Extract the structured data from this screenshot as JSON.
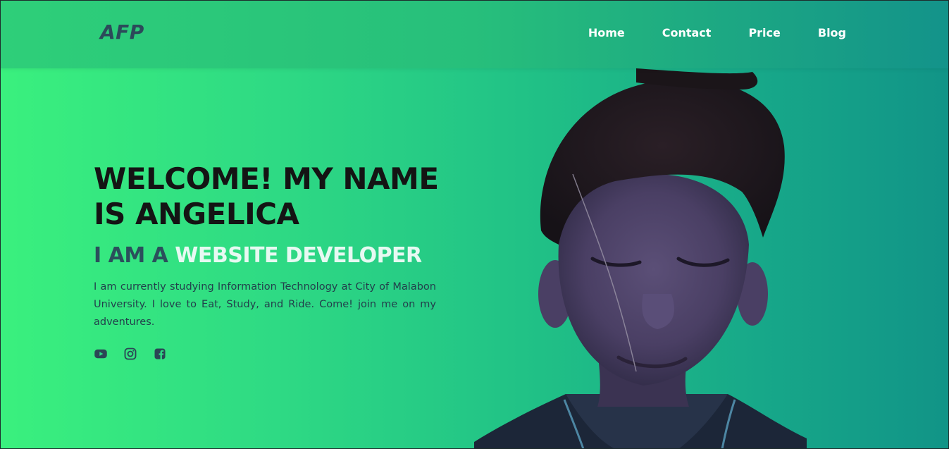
{
  "nav": {
    "logo": "AFP",
    "links": [
      {
        "label": "Home"
      },
      {
        "label": "Contact"
      },
      {
        "label": "Price"
      },
      {
        "label": "Blog"
      }
    ]
  },
  "hero": {
    "headline": "WELCOME! MY NAME IS ANGELICA",
    "sub_prefix": "I AM A",
    "sub_highlight": "WEBSITE DEVELOPER",
    "bio": "I am currently studying Information Technology at City of Malabon University. I love to Eat, Study, and Ride. Come! join me on my adventures.",
    "socials": [
      {
        "icon": "youtube-icon"
      },
      {
        "icon": "instagram-icon"
      },
      {
        "icon": "facebook-icon"
      }
    ]
  },
  "colors": {
    "gradient_start": "#3af07e",
    "gradient_end": "#119487",
    "logo": "#2c4a5a",
    "headline": "#141414",
    "sub_prefix": "#2b4f5c",
    "sub_highlight": "#e7f9f2",
    "bio": "#23404c"
  },
  "photo": {
    "description_icon": "profile-photo"
  }
}
